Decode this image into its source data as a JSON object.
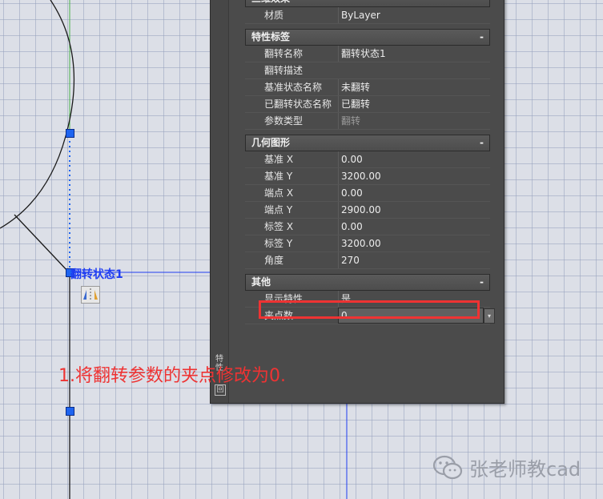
{
  "palette": {
    "sections": [
      {
        "title": "三维效果",
        "toggle": "-",
        "rows": [
          {
            "label": "材质",
            "value": "ByLayer"
          }
        ]
      },
      {
        "title": "特性标签",
        "toggle": "-",
        "rows": [
          {
            "label": "翻转名称",
            "value": "翻转状态1"
          },
          {
            "label": "翻转描述",
            "value": ""
          },
          {
            "label": "基准状态名称",
            "value": "未翻转"
          },
          {
            "label": "已翻转状态名称",
            "value": "已翻转"
          },
          {
            "label": "参数类型",
            "value": "翻转"
          }
        ]
      },
      {
        "title": "几何图形",
        "toggle": "-",
        "rows": [
          {
            "label": "基准 X",
            "value": "0.00"
          },
          {
            "label": "基准 Y",
            "value": "3200.00"
          },
          {
            "label": "端点 X",
            "value": "0.00"
          },
          {
            "label": "端点 Y",
            "value": "2900.00"
          },
          {
            "label": "标签 X",
            "value": "0.00"
          },
          {
            "label": "标签 Y",
            "value": "3200.00"
          },
          {
            "label": "角度",
            "value": "270"
          }
        ]
      },
      {
        "title": "其他",
        "toggle": "-",
        "rows": [
          {
            "label": "显示特性",
            "value": "是"
          },
          {
            "label": "夹点数",
            "value": "0"
          }
        ]
      }
    ],
    "strip": {
      "vertical_label": "特性"
    }
  },
  "canvas": {
    "flip_label": "翻转状态1"
  },
  "instruction": "1.将翻转参数的夹点修改为0.",
  "watermark": {
    "text": "张老师教cad"
  },
  "colors": {
    "grip": "#1e64f0",
    "flip_label": "#1f3df2",
    "instruction": "#ee3333",
    "palette_bg": "#4b4b4b"
  }
}
